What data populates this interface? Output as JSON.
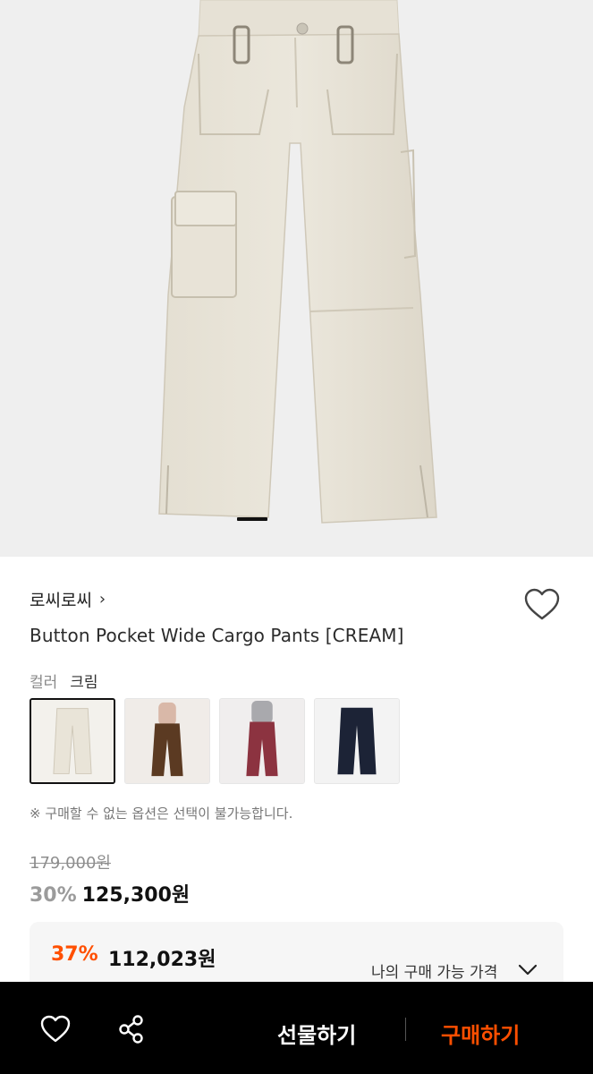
{
  "product": {
    "brand": "로씨로씨",
    "brand_chevron": "›",
    "title": "Button Pocket Wide Cargo Pants [CREAM]"
  },
  "option": {
    "label": "컬러",
    "value": "크림",
    "swatches": [
      {
        "color": "cream",
        "hex": "#e9e4d8",
        "selected": true
      },
      {
        "color": "brown",
        "hex": "#5b3a22",
        "selected": false
      },
      {
        "color": "berry",
        "hex": "#8c3340",
        "selected": false
      },
      {
        "color": "navy",
        "hex": "#1c2336",
        "selected": false
      }
    ],
    "notice": "※ 구매할 수 없는 옵션은 선택이 불가능합니다."
  },
  "price": {
    "original": "179,000원",
    "sale_rate": "30%",
    "sale_price": "125,300원",
    "my_rate": "37%",
    "my_price": "112,023원",
    "my_label": "나의 구매 가능 가격"
  },
  "bottom_bar": {
    "gift_label": "선물하기",
    "buy_label": "구매하기"
  },
  "colors": {
    "accent": "#ff4f00",
    "bar": "#000000"
  },
  "icons": [
    "heart-icon",
    "share-icon",
    "chevron-right-icon",
    "chevron-down-icon"
  ]
}
